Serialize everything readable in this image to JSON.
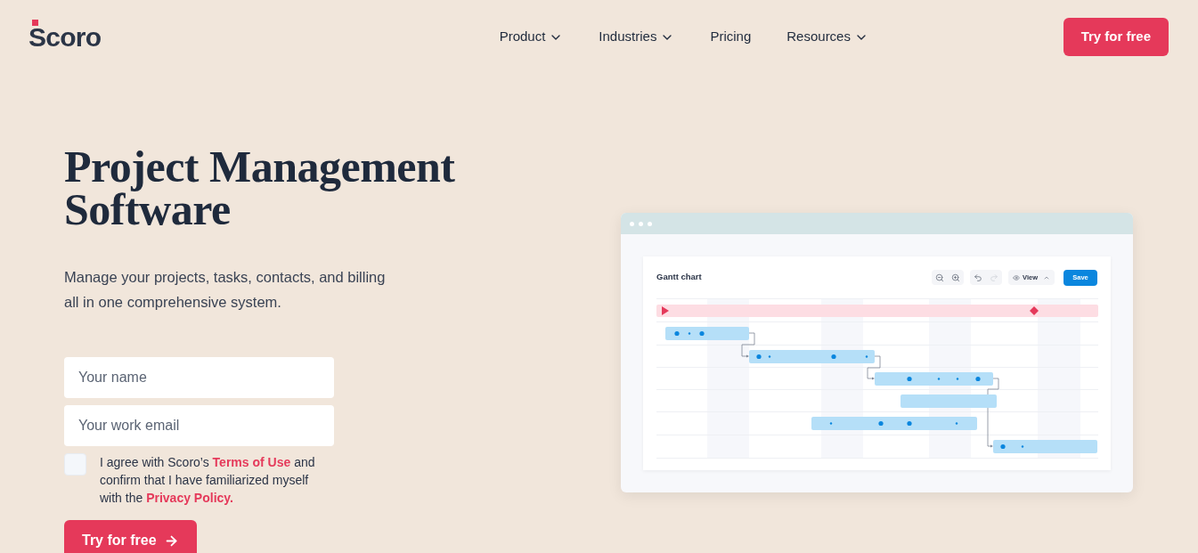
{
  "header": {
    "logo": "Scoro",
    "nav": [
      {
        "label": "Product",
        "has_menu": true
      },
      {
        "label": "Industries",
        "has_menu": true
      },
      {
        "label": "Pricing",
        "has_menu": false
      },
      {
        "label": "Resources",
        "has_menu": true
      }
    ],
    "cta": "Try for free"
  },
  "hero": {
    "title_lines": [
      "Project Management",
      "Software"
    ],
    "subtitle": "Manage your projects, tasks, contacts, and billing all in one comprehensive system.",
    "form": {
      "name": {
        "placeholder": "Your name"
      },
      "email": {
        "placeholder": "Your work email"
      },
      "consent": {
        "checked": false,
        "text_before": "I agree with Scoro’s",
        "terms_link": "Terms of Use",
        "text_middle": "and confirm that I have familiarized myself with the",
        "privacy_link": "Privacy Policy."
      },
      "submit": "Try for free"
    }
  },
  "gantt": {
    "title": "Gantt chart",
    "view_button": "View",
    "save_button": "Save",
    "undo_disabled": false,
    "redo_disabled": true
  }
}
